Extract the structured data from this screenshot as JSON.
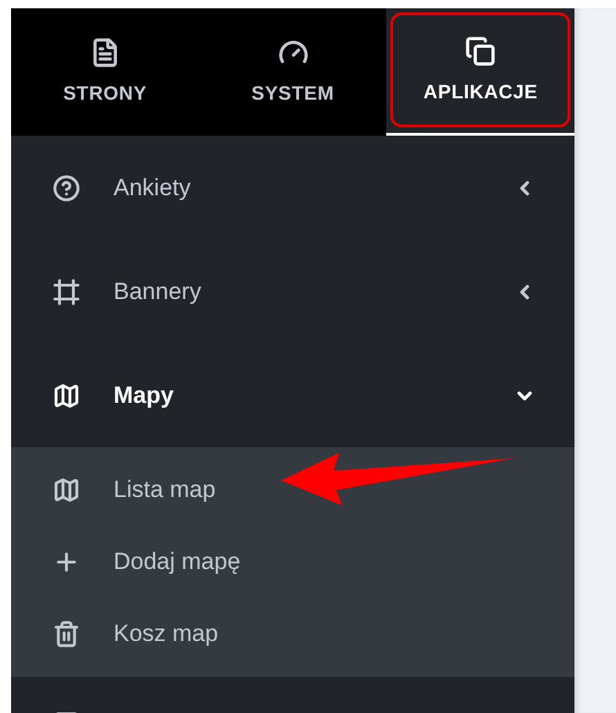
{
  "tabs": [
    {
      "label": "STRONY",
      "selected": false
    },
    {
      "label": "SYSTEM",
      "selected": false
    },
    {
      "label": "APLIKACJE",
      "selected": true
    }
  ],
  "menu": [
    {
      "label": "Ankiety",
      "expanded": false
    },
    {
      "label": "Bannery",
      "expanded": false
    },
    {
      "label": "Mapy",
      "expanded": true,
      "children": [
        {
          "label": "Lista map"
        },
        {
          "label": "Dodaj mapę"
        },
        {
          "label": "Kosz map"
        }
      ]
    }
  ]
}
